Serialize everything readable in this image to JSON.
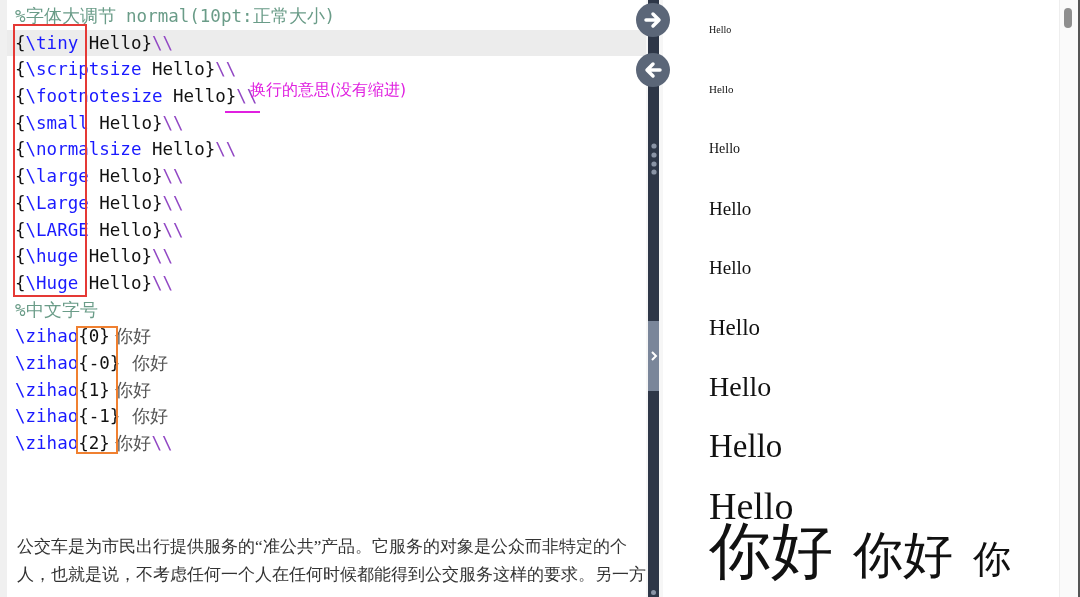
{
  "editor": {
    "lines": [
      {
        "highlighted": false,
        "tokens": [
          {
            "kind": "comment",
            "text": "%字体大调节 normal(10pt:正常大小)"
          }
        ]
      },
      {
        "highlighted": true,
        "tokens": [
          {
            "kind": "plain",
            "text": "{"
          },
          {
            "kind": "command",
            "text": "\\tiny"
          },
          {
            "kind": "plain",
            "text": " Hello}"
          },
          {
            "kind": "break",
            "text": "\\\\"
          }
        ]
      },
      {
        "highlighted": false,
        "tokens": [
          {
            "kind": "plain",
            "text": "{"
          },
          {
            "kind": "command",
            "text": "\\scriptsize"
          },
          {
            "kind": "plain",
            "text": " Hello}"
          },
          {
            "kind": "break",
            "text": "\\\\"
          }
        ]
      },
      {
        "highlighted": false,
        "tokens": [
          {
            "kind": "plain",
            "text": "{"
          },
          {
            "kind": "command",
            "text": "\\footnotesize"
          },
          {
            "kind": "plain",
            "text": " Hello}"
          },
          {
            "kind": "break",
            "text": "\\\\"
          }
        ]
      },
      {
        "highlighted": false,
        "tokens": [
          {
            "kind": "plain",
            "text": "{"
          },
          {
            "kind": "command",
            "text": "\\small"
          },
          {
            "kind": "plain",
            "text": " Hello}"
          },
          {
            "kind": "break",
            "text": "\\\\"
          }
        ]
      },
      {
        "highlighted": false,
        "tokens": [
          {
            "kind": "plain",
            "text": "{"
          },
          {
            "kind": "command",
            "text": "\\normalsize"
          },
          {
            "kind": "plain",
            "text": " Hello}"
          },
          {
            "kind": "break",
            "text": "\\\\"
          }
        ]
      },
      {
        "highlighted": false,
        "tokens": [
          {
            "kind": "plain",
            "text": "{"
          },
          {
            "kind": "command",
            "text": "\\large"
          },
          {
            "kind": "plain",
            "text": " Hello}"
          },
          {
            "kind": "break",
            "text": "\\\\"
          }
        ]
      },
      {
        "highlighted": false,
        "tokens": [
          {
            "kind": "plain",
            "text": "{"
          },
          {
            "kind": "command",
            "text": "\\Large"
          },
          {
            "kind": "plain",
            "text": " Hello}"
          },
          {
            "kind": "break",
            "text": "\\\\"
          }
        ]
      },
      {
        "highlighted": false,
        "tokens": [
          {
            "kind": "plain",
            "text": "{"
          },
          {
            "kind": "command",
            "text": "\\LARGE"
          },
          {
            "kind": "plain",
            "text": " Hello}"
          },
          {
            "kind": "break",
            "text": "\\\\"
          }
        ]
      },
      {
        "highlighted": false,
        "tokens": [
          {
            "kind": "plain",
            "text": "{"
          },
          {
            "kind": "command",
            "text": "\\huge"
          },
          {
            "kind": "plain",
            "text": " Hello}"
          },
          {
            "kind": "break",
            "text": "\\\\"
          }
        ]
      },
      {
        "highlighted": false,
        "tokens": [
          {
            "kind": "plain",
            "text": "{"
          },
          {
            "kind": "command",
            "text": "\\Huge"
          },
          {
            "kind": "plain",
            "text": " Hello}"
          },
          {
            "kind": "break",
            "text": "\\\\"
          }
        ]
      },
      {
        "highlighted": false,
        "tokens": [
          {
            "kind": "comment",
            "text": "%中文字号"
          }
        ]
      },
      {
        "highlighted": false,
        "tokens": [
          {
            "kind": "command",
            "text": "\\zihao"
          },
          {
            "kind": "plain",
            "text": "{0}"
          },
          {
            "kind": "cjk",
            "text": " 你好"
          }
        ]
      },
      {
        "highlighted": false,
        "tokens": [
          {
            "kind": "command",
            "text": "\\zihao"
          },
          {
            "kind": "plain",
            "text": "{-0}"
          },
          {
            "kind": "cjk",
            "text": "  你好"
          }
        ]
      },
      {
        "highlighted": false,
        "tokens": [
          {
            "kind": "command",
            "text": "\\zihao"
          },
          {
            "kind": "plain",
            "text": "{1}"
          },
          {
            "kind": "cjk",
            "text": " 你好"
          }
        ]
      },
      {
        "highlighted": false,
        "tokens": [
          {
            "kind": "command",
            "text": "\\zihao"
          },
          {
            "kind": "plain",
            "text": "{-1}"
          },
          {
            "kind": "cjk",
            "text": "  你好"
          }
        ]
      },
      {
        "highlighted": false,
        "tokens": [
          {
            "kind": "command",
            "text": "\\zihao"
          },
          {
            "kind": "plain",
            "text": "{2}"
          },
          {
            "kind": "cjk",
            "text": " 你好"
          },
          {
            "kind": "break",
            "text": "\\\\"
          }
        ]
      }
    ],
    "annotation": "换行的意思(没有缩进)",
    "paragraph": [
      "公交车是为市民出行提供服务的“准公共”产品。它服务的对象是公众而非特定的个",
      "人，也就是说，不考虑任何一个人在任何时候都能得到公交服务这样的要求。另一方"
    ]
  },
  "preview": {
    "lines": [
      {
        "kind": "tiny",
        "text": "Hello"
      },
      {
        "kind": "scriptsize",
        "text": "Hello"
      },
      {
        "kind": "footnotesize",
        "text": "Hello"
      },
      {
        "kind": "small",
        "text": "Hello"
      },
      {
        "kind": "normalsize",
        "text": "Hello"
      },
      {
        "kind": "large",
        "text": "Hello"
      },
      {
        "kind": "Large",
        "text": "Hello"
      },
      {
        "kind": "LARGE",
        "text": "Hello"
      },
      {
        "kind": "huge",
        "text": "Hello"
      }
    ],
    "chinese": [
      {
        "kind": "zihao0",
        "text": "你好"
      },
      {
        "kind": "zihaom0",
        "text": "你好"
      },
      {
        "kind": "zihao1",
        "text": "你"
      }
    ]
  }
}
